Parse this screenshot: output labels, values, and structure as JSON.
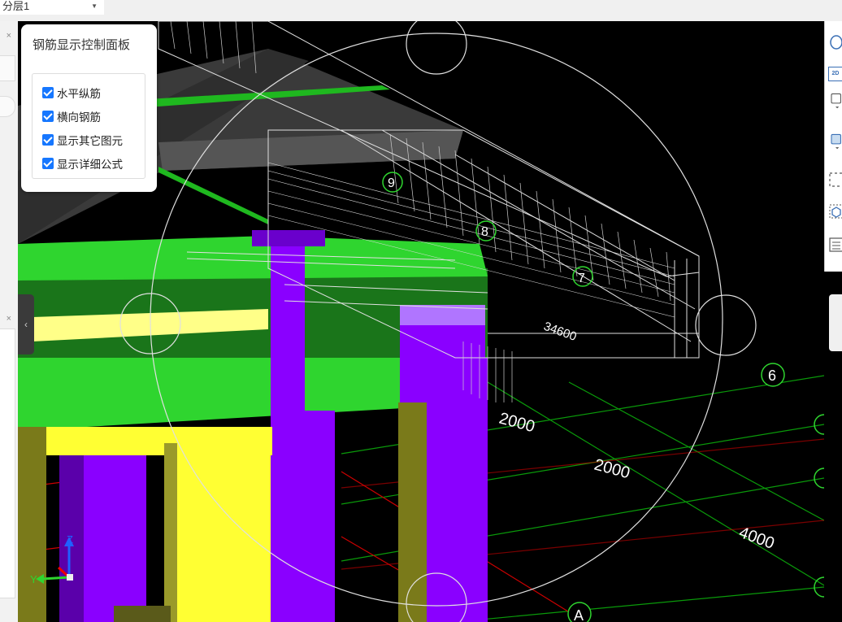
{
  "layer_selector": {
    "value": "分层1"
  },
  "rebar_panel": {
    "title": "钢筋显示控制面板",
    "options": [
      {
        "label": "水平纵筋",
        "checked": true
      },
      {
        "label": "横向钢筋",
        "checked": true
      },
      {
        "label": "显示其它图元",
        "checked": true
      },
      {
        "label": "显示详细公式",
        "checked": true
      }
    ]
  },
  "viewport": {
    "grid_labels": [
      "6",
      "A"
    ],
    "bar_numbers": [
      "9",
      "8",
      "7"
    ],
    "dimensions": [
      "34600",
      "2000",
      "2000",
      "4000"
    ],
    "axes": [
      "Z",
      "Y"
    ]
  },
  "right_toolbar": {
    "icons": [
      "orbit-icon",
      "2d-view-icon",
      "box-view-icon",
      "solid-view-icon",
      "selection-icon",
      "3d-cube-icon",
      "list-icon"
    ],
    "label_2d": "2D"
  },
  "colors": {
    "beam_green": "#2fd52f",
    "column_purple": "#8a00ff",
    "column_yellow": "#ffff33",
    "olive": "#7a7a1a",
    "slab_gray": "#4a4a4a",
    "rebar_white": "#dddddd",
    "checkbox_blue": "#1677ff"
  }
}
